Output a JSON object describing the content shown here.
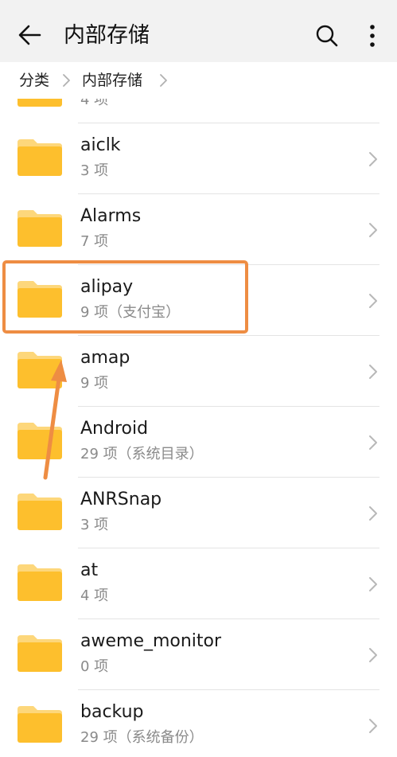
{
  "header": {
    "title": "内部存储",
    "back_icon": "arrow-left-icon",
    "search_icon": "search-icon",
    "more_icon": "more-vertical-icon"
  },
  "breadcrumb": {
    "items": [
      "分类",
      "内部存储"
    ]
  },
  "files": [
    {
      "name": "",
      "meta": "4 项"
    },
    {
      "name": "aiclk",
      "meta": "3 项"
    },
    {
      "name": "Alarms",
      "meta": "7 项"
    },
    {
      "name": "alipay",
      "meta": "9 项（支付宝）"
    },
    {
      "name": "amap",
      "meta": "9 项"
    },
    {
      "name": "Android",
      "meta": "29 项（系统目录）"
    },
    {
      "name": "ANRSnap",
      "meta": "3 项"
    },
    {
      "name": "at",
      "meta": "4 项"
    },
    {
      "name": "aweme_monitor",
      "meta": "0 项"
    },
    {
      "name": "backup",
      "meta": "29 项（系统备份）"
    }
  ],
  "colors": {
    "folder": "#fdbf2d",
    "folder_tab": "#fdd77b",
    "annotation": "#ee8d43"
  }
}
